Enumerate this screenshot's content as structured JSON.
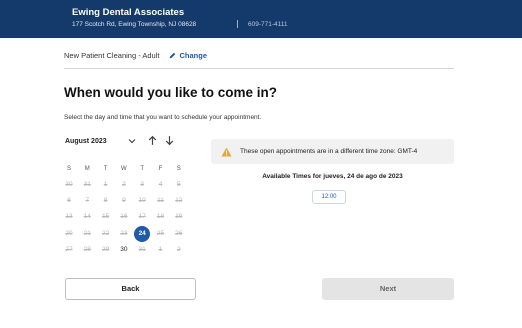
{
  "header": {
    "practice_name": "Ewing Dental Associates",
    "address": "177 Scotch Rd, Ewing Township, NJ 08628",
    "phone": "609-771-4111",
    "background_color": "#143a6b"
  },
  "service": {
    "name": "New Patient Cleaning - Adult",
    "change_label": "Change",
    "change_icon": "pencil-icon"
  },
  "page": {
    "heading": "When would you like to come in?",
    "instruction": "Select the day and time that you want to schedule your appointment."
  },
  "calendar": {
    "month_label": "August 2023",
    "month_dropdown_icon": "chevron-down-icon",
    "prev_icon": "arrow-up-icon",
    "next_icon": "arrow-down-icon",
    "weekdays": [
      "S",
      "M",
      "T",
      "W",
      "T",
      "F",
      "S"
    ],
    "weeks": [
      [
        {
          "d": "30",
          "s": "disabled"
        },
        {
          "d": "31",
          "s": "disabled"
        },
        {
          "d": "1",
          "s": "disabled"
        },
        {
          "d": "2",
          "s": "disabled"
        },
        {
          "d": "3",
          "s": "disabled"
        },
        {
          "d": "4",
          "s": "disabled"
        },
        {
          "d": "5",
          "s": "disabled"
        }
      ],
      [
        {
          "d": "6",
          "s": "disabled"
        },
        {
          "d": "7",
          "s": "disabled"
        },
        {
          "d": "8",
          "s": "disabled"
        },
        {
          "d": "9",
          "s": "disabled"
        },
        {
          "d": "10",
          "s": "disabled"
        },
        {
          "d": "11",
          "s": "disabled"
        },
        {
          "d": "12",
          "s": "disabled"
        }
      ],
      [
        {
          "d": "13",
          "s": "disabled"
        },
        {
          "d": "14",
          "s": "disabled"
        },
        {
          "d": "15",
          "s": "disabled"
        },
        {
          "d": "16",
          "s": "disabled"
        },
        {
          "d": "17",
          "s": "disabled"
        },
        {
          "d": "18",
          "s": "disabled"
        },
        {
          "d": "19",
          "s": "disabled"
        }
      ],
      [
        {
          "d": "20",
          "s": "disabled"
        },
        {
          "d": "21",
          "s": "disabled"
        },
        {
          "d": "22",
          "s": "disabled"
        },
        {
          "d": "23",
          "s": "disabled"
        },
        {
          "d": "24",
          "s": "selected"
        },
        {
          "d": "25",
          "s": "disabled"
        },
        {
          "d": "26",
          "s": "disabled"
        }
      ],
      [
        {
          "d": "27",
          "s": "disabled"
        },
        {
          "d": "28",
          "s": "disabled"
        },
        {
          "d": "29",
          "s": "disabled"
        },
        {
          "d": "30",
          "s": "available"
        },
        {
          "d": "31",
          "s": "disabled"
        },
        {
          "d": "1",
          "s": "disabled"
        },
        {
          "d": "2",
          "s": "disabled"
        }
      ]
    ],
    "selected_color": "#1f5aa8"
  },
  "timezone_notice": {
    "icon": "warning-icon",
    "text": "These open appointments are in a different time zone: GMT-4"
  },
  "availability": {
    "title": "Available Times for jueves, 24 de ago de 2023",
    "slots": [
      "12:00"
    ]
  },
  "actions": {
    "back_label": "Back",
    "next_label": "Next"
  }
}
